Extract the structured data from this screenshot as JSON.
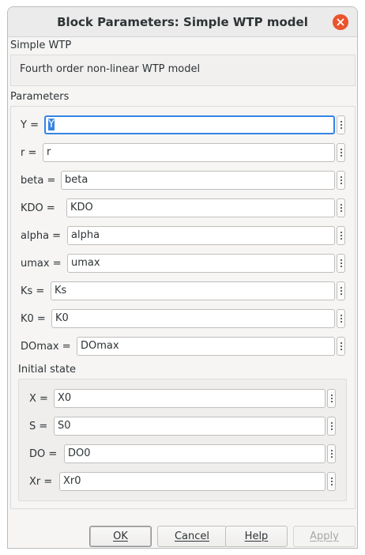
{
  "window": {
    "title": "Block Parameters: Simple WTP model"
  },
  "block": {
    "name": "Simple WTP",
    "description": "Fourth order non-linear WTP model"
  },
  "parameters": {
    "label": "Parameters",
    "fields": [
      {
        "label": "Y =",
        "value": "Y"
      },
      {
        "label": "r =",
        "value": "r"
      },
      {
        "label": "beta =",
        "value": "beta"
      },
      {
        "label": "KDO =",
        "value": "KDO"
      },
      {
        "label": "alpha =",
        "value": "alpha"
      },
      {
        "label": "umax =",
        "value": "umax"
      },
      {
        "label": "Ks =",
        "value": "Ks"
      },
      {
        "label": "K0 =",
        "value": "K0"
      },
      {
        "label": "DOmax =",
        "value": "DOmax"
      }
    ]
  },
  "initial_state": {
    "label": "Initial state",
    "fields": [
      {
        "label": "X =",
        "value": "X0"
      },
      {
        "label": "S =",
        "value": "S0"
      },
      {
        "label": "DO =",
        "value": "DO0"
      },
      {
        "label": "Xr =",
        "value": "Xr0"
      }
    ]
  },
  "buttons": {
    "ok": "OK",
    "cancel": "Cancel",
    "help": "Help",
    "apply": "Apply"
  },
  "colors": {
    "focus": "#3584e4",
    "close": "#e9542c"
  }
}
